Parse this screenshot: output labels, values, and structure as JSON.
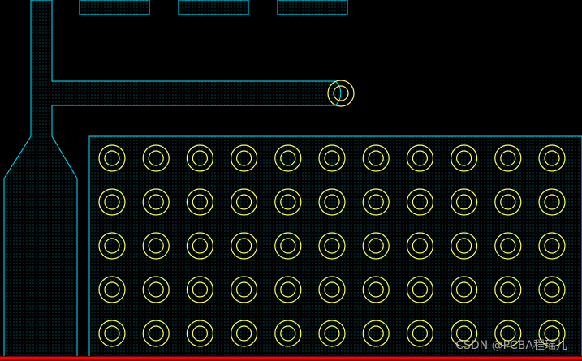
{
  "watermark_text": "CSDN @PCBA程瑶儿",
  "colors": {
    "background": "#000000",
    "copper_outline": "#00e5ff",
    "copper_fill_dot": "#0b3a44",
    "via_ring": "#ffff66",
    "bottom_strip": "#ff0000"
  },
  "via_grid": {
    "rows": 5,
    "cols": 11
  }
}
